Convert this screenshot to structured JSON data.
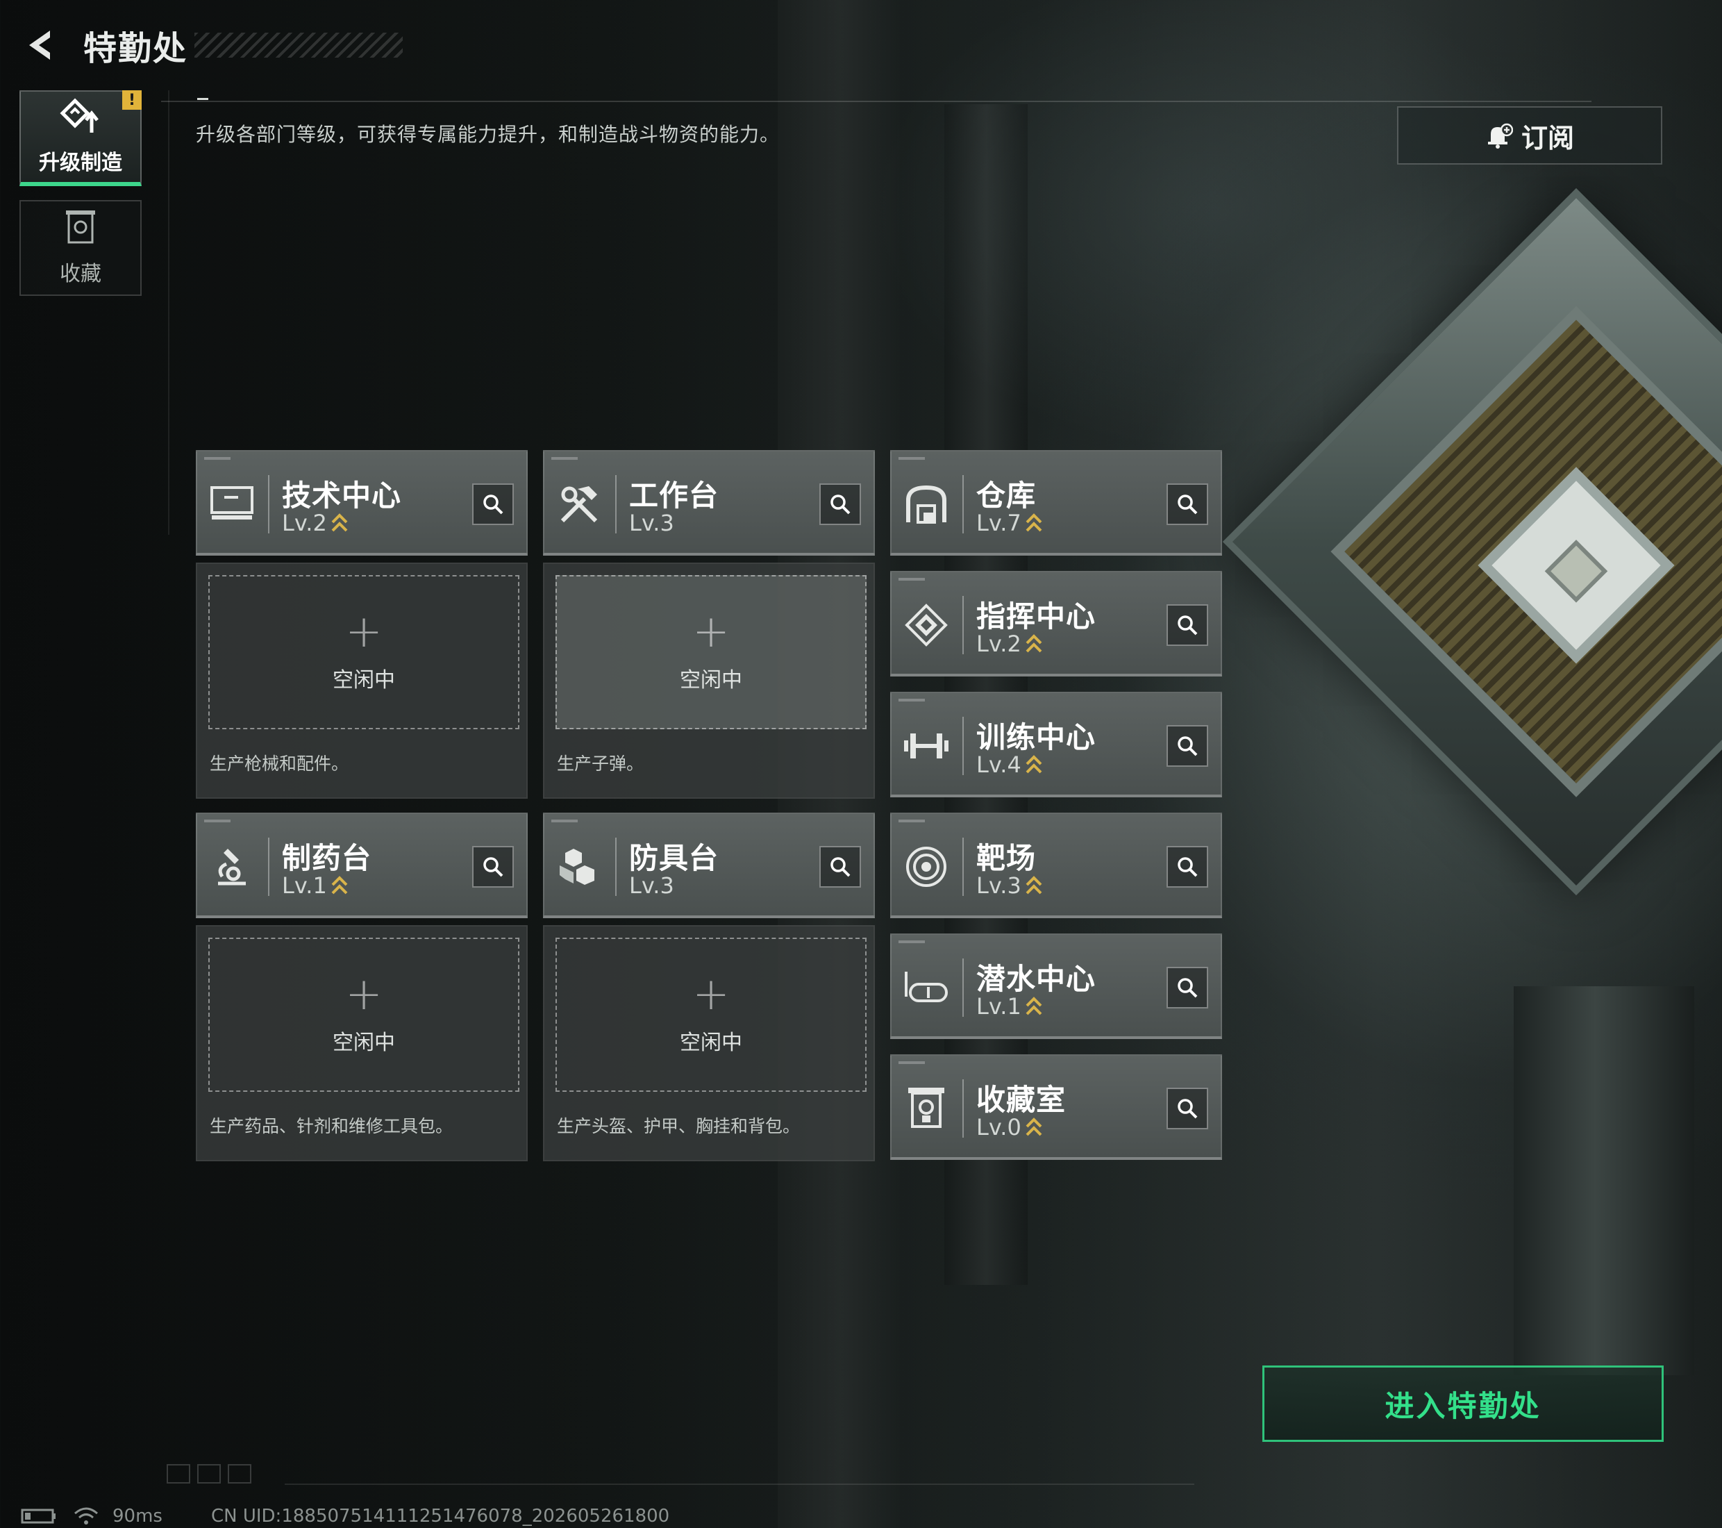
{
  "header": {
    "title": "特勤处"
  },
  "side_nav": [
    {
      "label": "升级制造",
      "icon": "upgrade-craft-icon",
      "active": true,
      "badge": "!"
    },
    {
      "label": "收藏",
      "icon": "collection-icon",
      "active": false
    }
  ],
  "description": "升级各部门等级，可获得专属能力提升，和制造战斗物资的能力。",
  "subscribe": {
    "label": "订阅",
    "icon": "bell-plus-icon"
  },
  "departments": [
    {
      "name": "技术中心",
      "level": "Lv.2",
      "upgradable": true,
      "icon": "monitor-icon"
    },
    {
      "name": "工作台",
      "level": "Lv.3",
      "upgradable": false,
      "icon": "hammer-wrench-icon"
    },
    {
      "name": "仓库",
      "level": "Lv.7",
      "upgradable": true,
      "icon": "warehouse-icon"
    },
    {
      "name": "指挥中心",
      "level": "Lv.2",
      "upgradable": true,
      "icon": "command-diamond-icon"
    },
    {
      "name": "训练中心",
      "level": "Lv.4",
      "upgradable": true,
      "icon": "dumbbell-icon"
    },
    {
      "name": "制药台",
      "level": "Lv.1",
      "upgradable": true,
      "icon": "microscope-icon"
    },
    {
      "name": "防具台",
      "level": "Lv.3",
      "upgradable": false,
      "icon": "armor-blocks-icon"
    },
    {
      "name": "靶场",
      "level": "Lv.3",
      "upgradable": true,
      "icon": "target-icon"
    },
    {
      "name": "潜水中心",
      "level": "Lv.1",
      "upgradable": true,
      "icon": "diving-mask-icon"
    },
    {
      "name": "收藏室",
      "level": "Lv.0",
      "upgradable": true,
      "icon": "display-case-icon"
    }
  ],
  "production": [
    {
      "slot_label": "空闲中",
      "description": "生产枪械和配件。"
    },
    {
      "slot_label": "空闲中",
      "description": "生产子弹。"
    },
    {
      "slot_label": "空闲中",
      "description": "生产药品、针剂和维修工具包。"
    },
    {
      "slot_label": "空闲中",
      "description": "生产头盔、护甲、胸挂和背包。"
    }
  ],
  "enter_button": {
    "label": "进入特勤处"
  },
  "status_bar": {
    "ping": "90ms",
    "uid": "CN UID:18850751411125147607​8_202605261800"
  },
  "colors": {
    "accent_green": "#33e08a",
    "warning_yellow": "#e1b33a",
    "upgrade_arrow": "#d9b44a"
  }
}
